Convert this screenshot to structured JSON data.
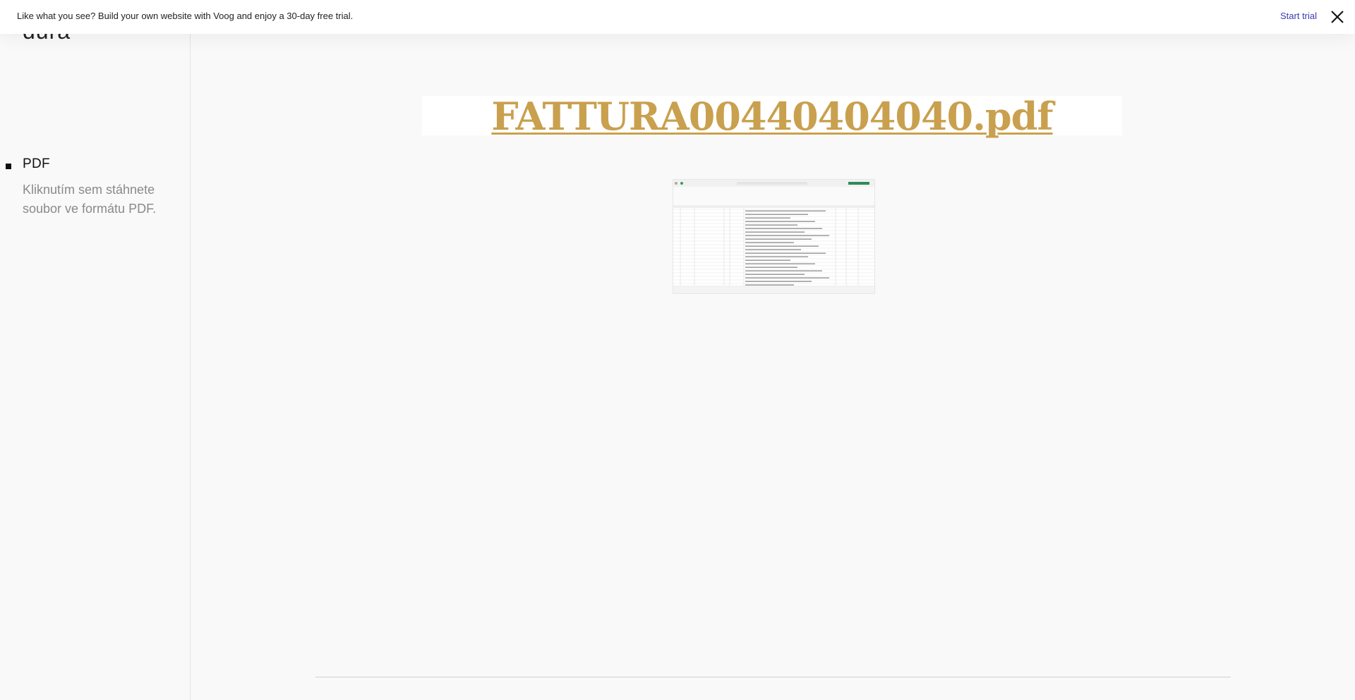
{
  "banner": {
    "text": "Like what you see? Build your own website with Voog and enjoy a 30-day free trial.",
    "start_trial_label": "Start trial",
    "close_icon": "close-icon"
  },
  "sidebar": {
    "logo_text": "dura",
    "file": {
      "title": "PDF",
      "description": "Kliknutím sem stáhnete soubor ve formátu PDF."
    }
  },
  "main": {
    "document_link": "FATTURA00440404040.pdf",
    "thumbnail_icon": "spreadsheet-thumbnail"
  },
  "colors": {
    "link_gold": "#c9a04e",
    "banner_link": "#3a3ab0",
    "sidebar_bg": "#f9f9f9"
  }
}
